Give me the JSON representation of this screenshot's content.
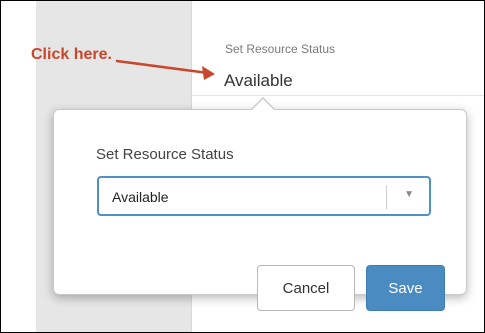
{
  "header": {
    "label": "Set Resource Status",
    "value": "Available"
  },
  "annotation": {
    "callout_text": "Click here.",
    "color": "#c9472a"
  },
  "popover": {
    "title": "Set Resource Status",
    "select": {
      "selected_value": "Available",
      "chevron_icon": "chevron-down-icon"
    },
    "buttons": {
      "cancel_label": "Cancel",
      "save_label": "Save"
    }
  },
  "colors": {
    "accent": "#4a8bc2",
    "focus_border": "#4f90c6",
    "sidebar": "#e6e6e6"
  }
}
